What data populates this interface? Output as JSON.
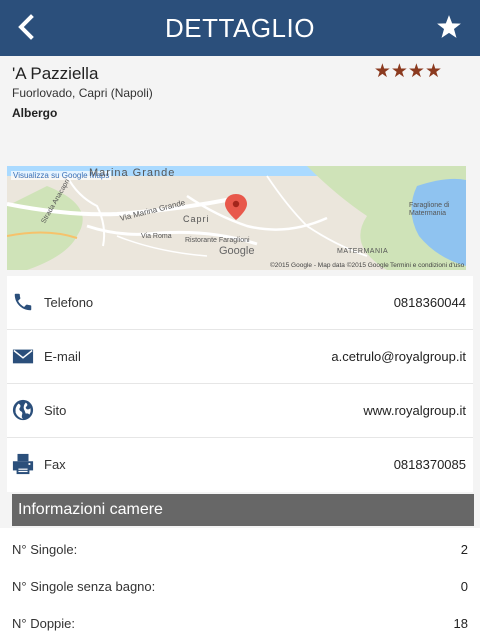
{
  "header": {
    "title": "DETTAGLIO",
    "back_icon": "chevron-left-icon",
    "favorite_icon": "star-icon"
  },
  "hotel": {
    "name": "'A Pazziella",
    "address": "Fuorlovado, Capri (Napoli)",
    "type": "Albergo",
    "rating_stars": 4,
    "stars_text": "★★★★",
    "star_color": "#8b3a1f"
  },
  "map": {
    "link": "Visualizza su Google Maps",
    "labels": {
      "marina_grande": "Marina Grande",
      "via_marina_grande": "Via Marina Grande",
      "capri": "Capri",
      "via_roma": "Via Roma",
      "ristorante": "Ristorante Faraglioni",
      "faraglione": "Faraglione di Matermania",
      "matermania": "MATERMANIA",
      "anacapri": "Strada Anacapri"
    },
    "brand": "Google",
    "copyright": "©2015 Google - Map data ©2015 Google",
    "terms": "Termini e condizioni d'uso"
  },
  "contacts": [
    {
      "icon": "phone-icon",
      "label": "Telefono",
      "value": "0818360044"
    },
    {
      "icon": "mail-icon",
      "label": "E-mail",
      "value": "a.cetrulo@royalgroup.it"
    },
    {
      "icon": "globe-icon",
      "label": "Sito",
      "value": "www.royalgroup.it"
    },
    {
      "icon": "fax-icon",
      "label": "Fax",
      "value": "0818370085"
    }
  ],
  "rooms": {
    "title": "Informazioni camere",
    "items": [
      {
        "label": "N° Singole:",
        "value": "2"
      },
      {
        "label": "N° Singole senza bagno:",
        "value": "0"
      },
      {
        "label": "N° Doppie:",
        "value": "18"
      }
    ]
  },
  "colors": {
    "header": "#2b4f7b",
    "icon": "#2b4f7b",
    "section": "#676767"
  }
}
